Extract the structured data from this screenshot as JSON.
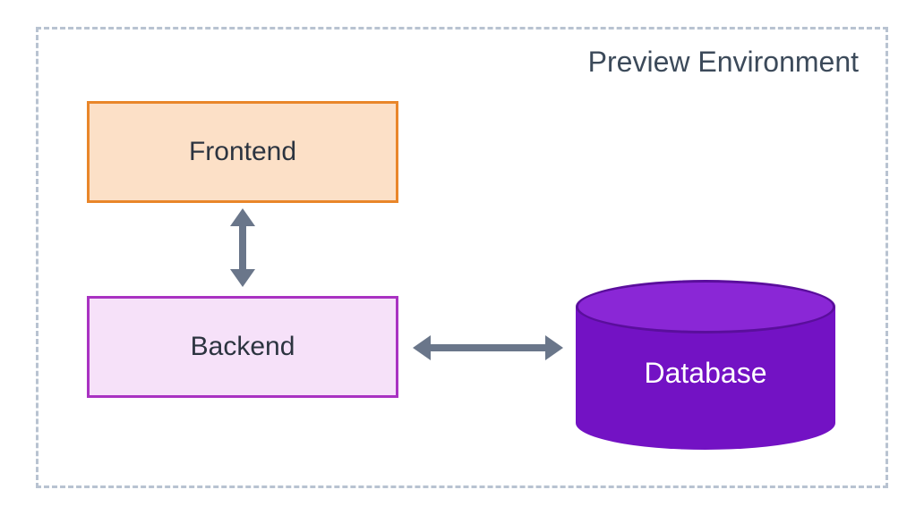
{
  "diagram": {
    "title": "Preview Environment",
    "nodes": {
      "frontend": {
        "label": "Frontend",
        "shape": "box",
        "fill": "#fce0c7",
        "stroke": "#e9862a"
      },
      "backend": {
        "label": "Backend",
        "shape": "box",
        "fill": "#f6e1f9",
        "stroke": "#a932c2"
      },
      "database": {
        "label": "Database",
        "shape": "cylinder",
        "fill": "#7312c4",
        "top_fill": "#8a27d6",
        "text_color": "#ffffff"
      }
    },
    "edges": [
      {
        "from": "frontend",
        "to": "backend",
        "direction": "bidirectional",
        "orientation": "vertical"
      },
      {
        "from": "backend",
        "to": "database",
        "direction": "bidirectional",
        "orientation": "horizontal"
      }
    ],
    "colors": {
      "container_border": "#b8c3d1",
      "arrow": "#6a768a",
      "title_text": "#3c4a5a"
    }
  }
}
